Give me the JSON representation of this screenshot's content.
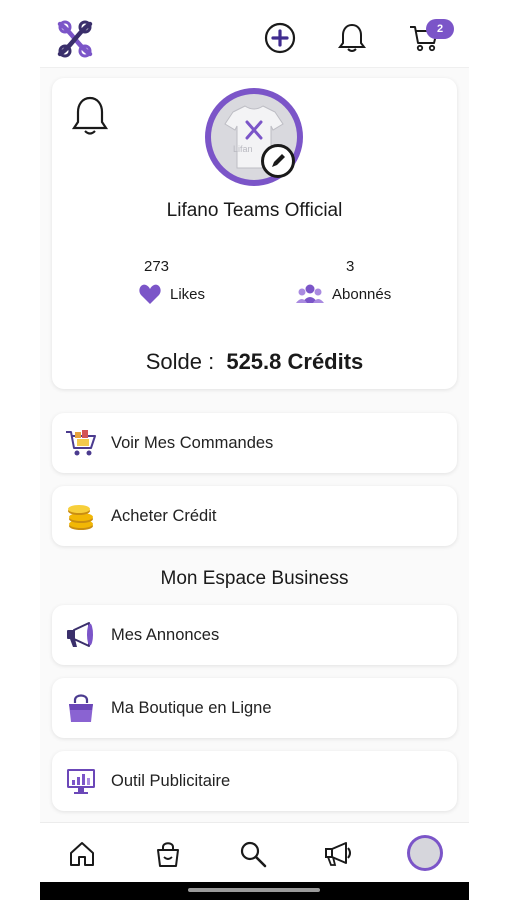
{
  "colors": {
    "accent": "#7b55c8",
    "accent_light": "#a98ae0",
    "text": "#1a1a1a"
  },
  "header": {
    "logo_icon": "lifano-logo",
    "add_icon": "plus-circle-icon",
    "notifications_icon": "bell-icon",
    "cart_icon": "cart-icon",
    "cart_count": "2"
  },
  "profile": {
    "name": "Lifano Teams Official",
    "likes_count": "273",
    "likes_label": "Likes",
    "followers_count": "3",
    "followers_label": "Abonnés",
    "balance_label": "Solde :",
    "balance_value": "525.8 Crédits",
    "avatar_text": "Lifan"
  },
  "menu": [
    {
      "label": "Voir Mes Commandes",
      "icon": "shopping-cart-icon"
    },
    {
      "label": "Acheter Crédit",
      "icon": "coins-icon"
    }
  ],
  "business": {
    "title": "Mon Espace Business",
    "items": [
      {
        "label": "Mes Annonces",
        "icon": "megaphone-icon"
      },
      {
        "label": "Ma Boutique en Ligne",
        "icon": "shopping-bag-icon"
      },
      {
        "label": "Outil Publicitaire",
        "icon": "analytics-monitor-icon"
      }
    ]
  },
  "bottom_nav": [
    "home-icon",
    "bag-icon",
    "search-icon",
    "megaphone-icon",
    "profile-avatar"
  ]
}
